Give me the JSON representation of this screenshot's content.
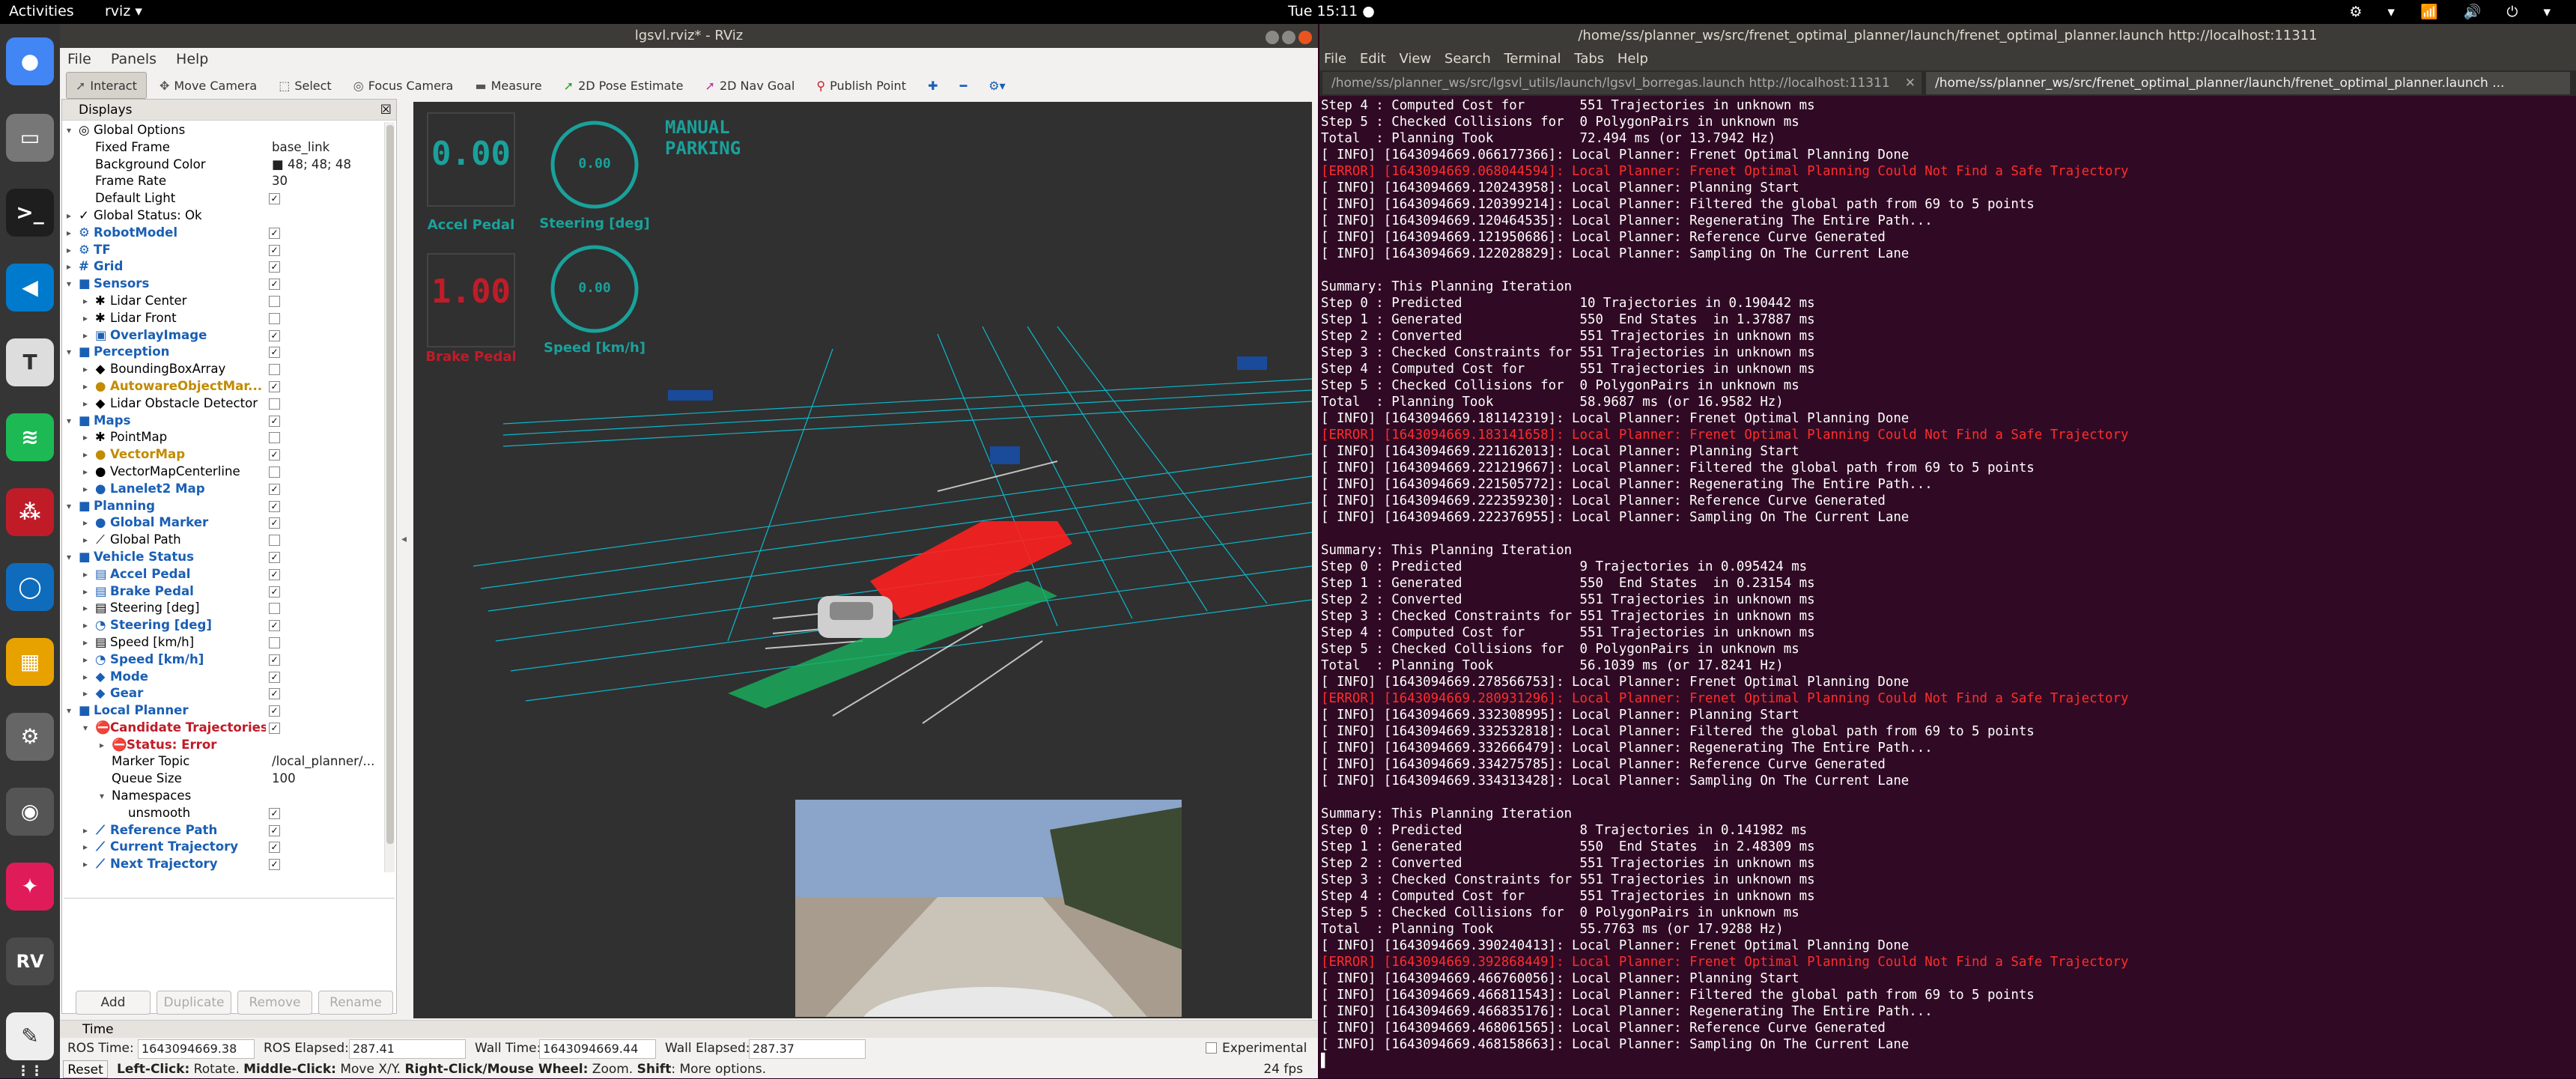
{
  "topbar": {
    "activities": "Activities",
    "app_menu": "rviz ▾",
    "clock": "Tue 15:11 ●",
    "tray": "⚙ ▾ 📶 🔊 ⏻ ▾"
  },
  "rviz": {
    "title": "lgsvl.rviz* - RViz",
    "menu": [
      "File",
      "Panels",
      "Help"
    ],
    "tools": [
      "Interact",
      "Move Camera",
      "Select",
      "Focus Camera",
      "Measure",
      "2D Pose Estimate",
      "2D Nav Goal",
      "Publish Point"
    ],
    "displays_title": "Displays",
    "tree": [
      {
        "d": 0,
        "exp": "▾",
        "icon": "◎",
        "label": "Global Options",
        "style": ""
      },
      {
        "d": 1,
        "label": "Fixed Frame",
        "val": "base_link"
      },
      {
        "d": 1,
        "label": "Background Color",
        "val": "■ 48; 48; 48"
      },
      {
        "d": 1,
        "label": "Frame Rate",
        "val": "30"
      },
      {
        "d": 1,
        "label": "Default Light",
        "chk": "✓"
      },
      {
        "d": 0,
        "exp": "▸",
        "icon": "✓",
        "label": "Global Status: Ok",
        "style": ""
      },
      {
        "d": 0,
        "exp": "▸",
        "icon": "⚙",
        "label": "RobotModel",
        "style": "blue",
        "chk": "✓"
      },
      {
        "d": 0,
        "exp": "▸",
        "icon": "⚙",
        "label": "TF",
        "style": "blue",
        "chk": "✓"
      },
      {
        "d": 0,
        "exp": "▸",
        "icon": "#",
        "label": "Grid",
        "style": "blue",
        "chk": "✓"
      },
      {
        "d": 0,
        "exp": "▾",
        "icon": "■",
        "label": "Sensors",
        "style": "blue",
        "chk": "✓"
      },
      {
        "d": 1,
        "exp": "▸",
        "icon": "✱",
        "label": "Lidar Center",
        "chk": ""
      },
      {
        "d": 1,
        "exp": "▸",
        "icon": "✱",
        "label": "Lidar Front",
        "chk": ""
      },
      {
        "d": 1,
        "exp": "▸",
        "icon": "▣",
        "label": "OverlayImage",
        "style": "blue",
        "chk": "✓"
      },
      {
        "d": 0,
        "exp": "▾",
        "icon": "■",
        "label": "Perception",
        "style": "blue",
        "chk": "✓"
      },
      {
        "d": 1,
        "exp": "▸",
        "icon": "◆",
        "label": "BoundingBoxArray",
        "chk": ""
      },
      {
        "d": 1,
        "exp": "▸",
        "icon": "●",
        "label": "AutowareObjectMar...",
        "style": "orange",
        "chk": "✓"
      },
      {
        "d": 1,
        "exp": "▸",
        "icon": "◆",
        "label": "Lidar Obstacle Detector",
        "chk": ""
      },
      {
        "d": 0,
        "exp": "▾",
        "icon": "■",
        "label": "Maps",
        "style": "blue",
        "chk": "✓"
      },
      {
        "d": 1,
        "exp": "▸",
        "icon": "✱",
        "label": "PointMap",
        "chk": ""
      },
      {
        "d": 1,
        "exp": "▸",
        "icon": "●",
        "label": "VectorMap",
        "style": "orange",
        "chk": "✓"
      },
      {
        "d": 1,
        "exp": "▸",
        "icon": "●",
        "label": "VectorMapCenterline",
        "chk": ""
      },
      {
        "d": 1,
        "exp": "▸",
        "icon": "●",
        "label": "Lanelet2 Map",
        "style": "blue",
        "chk": "✓"
      },
      {
        "d": 0,
        "exp": "▾",
        "icon": "■",
        "label": "Planning",
        "style": "blue",
        "chk": "✓"
      },
      {
        "d": 1,
        "exp": "▸",
        "icon": "●",
        "label": "Global Marker",
        "style": "blue",
        "chk": "✓"
      },
      {
        "d": 1,
        "exp": "▸",
        "icon": "⟋",
        "label": "Global Path",
        "chk": ""
      },
      {
        "d": 0,
        "exp": "▾",
        "icon": "■",
        "label": "Vehicle Status",
        "style": "blue",
        "chk": "✓"
      },
      {
        "d": 1,
        "exp": "▸",
        "icon": "▤",
        "label": "Accel Pedal",
        "style": "blue",
        "chk": "✓"
      },
      {
        "d": 1,
        "exp": "▸",
        "icon": "▤",
        "label": "Brake Pedal",
        "style": "blue",
        "chk": "✓"
      },
      {
        "d": 1,
        "exp": "▸",
        "icon": "▤",
        "label": "Steering [deg]",
        "chk": ""
      },
      {
        "d": 1,
        "exp": "▸",
        "icon": "◔",
        "label": "Steering [deg]",
        "style": "blue",
        "chk": "✓"
      },
      {
        "d": 1,
        "exp": "▸",
        "icon": "▤",
        "label": "Speed [km/h]",
        "chk": ""
      },
      {
        "d": 1,
        "exp": "▸",
        "icon": "◔",
        "label": "Speed [km/h]",
        "style": "blue",
        "chk": "✓"
      },
      {
        "d": 1,
        "exp": "▸",
        "icon": "◆",
        "label": "Mode",
        "style": "blue",
        "chk": "✓"
      },
      {
        "d": 1,
        "exp": "▸",
        "icon": "◆",
        "label": "Gear",
        "style": "blue",
        "chk": "✓"
      },
      {
        "d": 0,
        "exp": "▾",
        "icon": "■",
        "label": "Local Planner",
        "style": "blue",
        "chk": "✓"
      },
      {
        "d": 1,
        "exp": "▾",
        "icon": "⛔",
        "label": "Candidate Trajectories",
        "style": "red",
        "chk": "✓"
      },
      {
        "d": 2,
        "exp": "▸",
        "icon": "⛔",
        "label": "Status: Error",
        "style": "red"
      },
      {
        "d": 2,
        "label": "Marker Topic",
        "val": "/local_planner/..."
      },
      {
        "d": 2,
        "label": "Queue Size",
        "val": "100"
      },
      {
        "d": 2,
        "exp": "▾",
        "label": "Namespaces"
      },
      {
        "d": 3,
        "label": "unsmooth",
        "chk": "✓"
      },
      {
        "d": 1,
        "exp": "▸",
        "icon": "⟋",
        "label": "Reference Path",
        "style": "blue",
        "chk": "✓"
      },
      {
        "d": 1,
        "exp": "▸",
        "icon": "⟋",
        "label": "Current Trajectory",
        "style": "blue",
        "chk": "✓"
      },
      {
        "d": 1,
        "exp": "▸",
        "icon": "⟋",
        "label": "Next Trajectory",
        "style": "blue",
        "chk": "✓"
      }
    ],
    "buttons": [
      "Add",
      "Duplicate",
      "Remove",
      "Rename"
    ],
    "hud": {
      "accel_value": "0.00",
      "accel_label": "Accel Pedal",
      "brake_value": "1.00",
      "brake_label": "Brake Pedal",
      "steer_value": "0.00",
      "steer_label": "Steering [deg]",
      "speed_value": "0.00",
      "speed_label": "Speed [km/h]",
      "mode_line1": "MANUAL",
      "mode_line2": "PARKING"
    },
    "time": {
      "panel_title": "Time",
      "ros_time_label": "ROS Time:",
      "ros_time": "1643094669.38",
      "ros_elapsed_label": "ROS Elapsed:",
      "ros_elapsed": "287.41",
      "wall_time_label": "Wall Time:",
      "wall_time": "1643094669.44",
      "wall_elapsed_label": "Wall Elapsed:",
      "wall_elapsed": "287.37",
      "experimental": "Experimental"
    },
    "status": {
      "reset": "Reset",
      "hint_b1": "Left-Click:",
      "hint_t1": " Rotate. ",
      "hint_b2": "Middle-Click:",
      "hint_t2": " Move X/Y. ",
      "hint_b3": "Right-Click/Mouse Wheel:",
      "hint_t3": " Zoom. ",
      "hint_b4": "Shift",
      "hint_t4": ": More options.",
      "fps": "24 fps"
    },
    "colors": {
      "hud_teal": "#1aa19b",
      "hud_red": "#c01c28",
      "trajectory": "#ff2020",
      "road_lines": "#00e5ff"
    }
  },
  "terminal": {
    "title": "/home/ss/planner_ws/src/frenet_optimal_planner/launch/frenet_optimal_planner.launch http://localhost:11311",
    "menu": [
      "File",
      "Edit",
      "View",
      "Search",
      "Terminal",
      "Tabs",
      "Help"
    ],
    "tabs": [
      "/home/ss/planner_ws/src/lgsvl_utils/launch/lgsvl_borregas.launch http://localhost:11311",
      "/home/ss/planner_ws/src/frenet_optimal_planner/launch/frenet_optimal_planner.launch ..."
    ],
    "lines": [
      "Step 4 : Computed Cost for       551 Trajectories in unknown ms",
      "Step 5 : Checked Collisions for  0 PolygonPairs in unknown ms",
      "Total  : Planning Took           72.494 ms (or 13.7942 Hz)",
      "[ INFO] [1643094669.066177366]: Local Planner: Frenet Optimal Planning Done",
      "[ERROR] [1643094669.068044594]: Local Planner: Frenet Optimal Planning Could Not Find a Safe Trajectory",
      "[ INFO] [1643094669.120243958]: Local Planner: Planning Start",
      "[ INFO] [1643094669.120399214]: Local Planner: Filtered the global path from 69 to 5 points",
      "[ INFO] [1643094669.120464535]: Local Planner: Regenerating The Entire Path...",
      "[ INFO] [1643094669.121950686]: Local Planner: Reference Curve Generated",
      "[ INFO] [1643094669.122028829]: Local Planner: Sampling On The Current Lane",
      "",
      "Summary: This Planning Iteration",
      "Step 0 : Predicted               10 Trajectories in 0.190442 ms",
      "Step 1 : Generated               550  End States  in 1.37887 ms",
      "Step 2 : Converted               551 Trajectories in unknown ms",
      "Step 3 : Checked Constraints for 551 Trajectories in unknown ms",
      "Step 4 : Computed Cost for       551 Trajectories in unknown ms",
      "Step 5 : Checked Collisions for  0 PolygonPairs in unknown ms",
      "Total  : Planning Took           58.9687 ms (or 16.9582 Hz)",
      "[ INFO] [1643094669.181142319]: Local Planner: Frenet Optimal Planning Done",
      "[ERROR] [1643094669.183141658]: Local Planner: Frenet Optimal Planning Could Not Find a Safe Trajectory",
      "[ INFO] [1643094669.221162013]: Local Planner: Planning Start",
      "[ INFO] [1643094669.221219667]: Local Planner: Filtered the global path from 69 to 5 points",
      "[ INFO] [1643094669.221505772]: Local Planner: Regenerating The Entire Path...",
      "[ INFO] [1643094669.222359230]: Local Planner: Reference Curve Generated",
      "[ INFO] [1643094669.222376955]: Local Planner: Sampling On The Current Lane",
      "",
      "Summary: This Planning Iteration",
      "Step 0 : Predicted               9 Trajectories in 0.095424 ms",
      "Step 1 : Generated               550  End States  in 0.23154 ms",
      "Step 2 : Converted               551 Trajectories in unknown ms",
      "Step 3 : Checked Constraints for 551 Trajectories in unknown ms",
      "Step 4 : Computed Cost for       551 Trajectories in unknown ms",
      "Step 5 : Checked Collisions for  0 PolygonPairs in unknown ms",
      "Total  : Planning Took           56.1039 ms (or 17.8241 Hz)",
      "[ INFO] [1643094669.278566753]: Local Planner: Frenet Optimal Planning Done",
      "[ERROR] [1643094669.280931296]: Local Planner: Frenet Optimal Planning Could Not Find a Safe Trajectory",
      "[ INFO] [1643094669.332308995]: Local Planner: Planning Start",
      "[ INFO] [1643094669.332532818]: Local Planner: Filtered the global path from 69 to 5 points",
      "[ INFO] [1643094669.332666479]: Local Planner: Regenerating The Entire Path...",
      "[ INFO] [1643094669.334275785]: Local Planner: Reference Curve Generated",
      "[ INFO] [1643094669.334313428]: Local Planner: Sampling On The Current Lane",
      "",
      "Summary: This Planning Iteration",
      "Step 0 : Predicted               8 Trajectories in 0.141982 ms",
      "Step 1 : Generated               550  End States  in 2.48309 ms",
      "Step 2 : Converted               551 Trajectories in unknown ms",
      "Step 3 : Checked Constraints for 551 Trajectories in unknown ms",
      "Step 4 : Computed Cost for       551 Trajectories in unknown ms",
      "Step 5 : Checked Collisions for  0 PolygonPairs in unknown ms",
      "Total  : Planning Took           55.7763 ms (or 17.9288 Hz)",
      "[ INFO] [1643094669.390240413]: Local Planner: Frenet Optimal Planning Done",
      "[ERROR] [1643094669.392868449]: Local Planner: Frenet Optimal Planning Could Not Find a Safe Trajectory",
      "[ INFO] [1643094669.466760056]: Local Planner: Planning Start",
      "[ INFO] [1643094669.466811543]: Local Planner: Filtered the global path from 69 to 5 points",
      "[ INFO] [1643094669.466835176]: Local Planner: Regenerating The Entire Path...",
      "[ INFO] [1643094669.468061565]: Local Planner: Reference Curve Generated",
      "[ INFO] [1643094669.468158663]: Local Planner: Sampling On The Current Lane",
      "▌"
    ]
  }
}
